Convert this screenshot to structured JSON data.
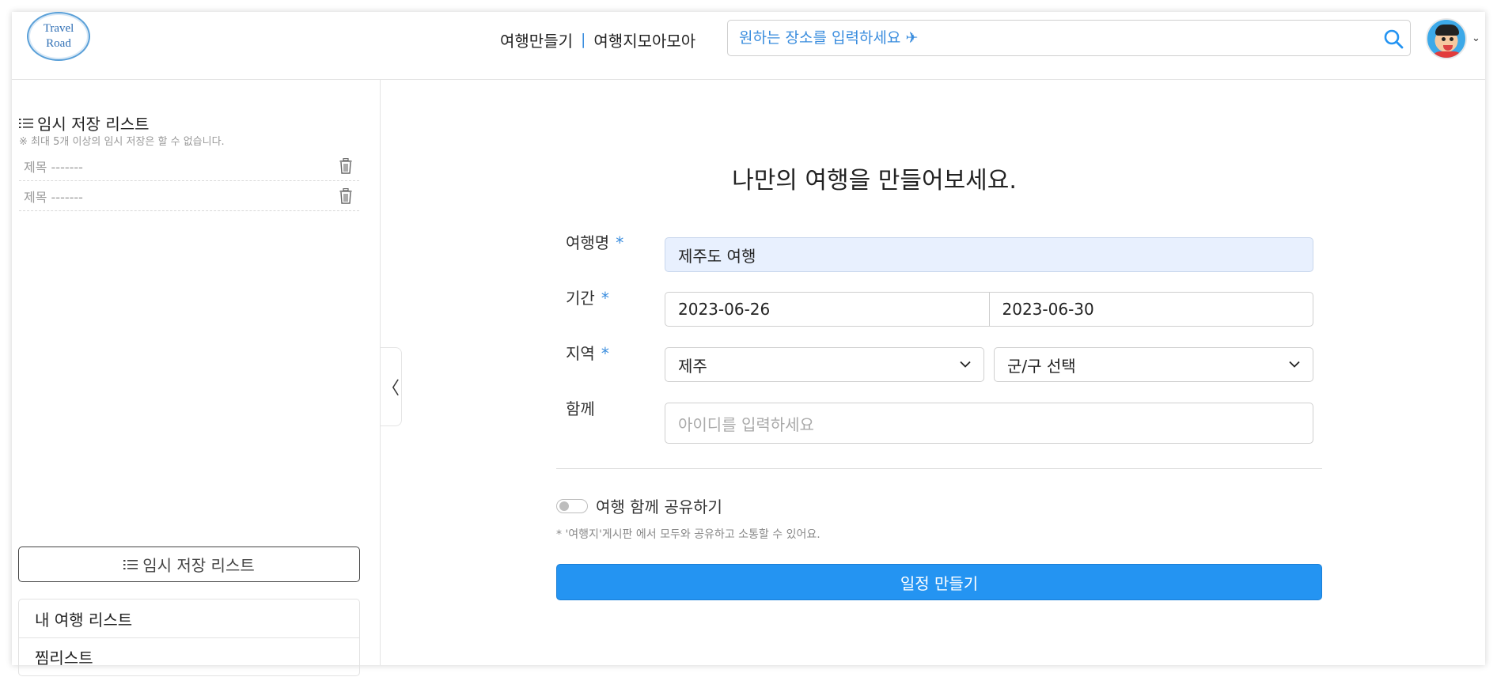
{
  "header": {
    "logo_line1": "Travel",
    "logo_line2": "Road",
    "nav": [
      {
        "label": "여행만들기"
      },
      {
        "label": "여행지모아모아"
      }
    ],
    "nav_separator": "|",
    "search": {
      "placeholder": "원하는 장소를 입력하세요 ✈"
    },
    "avatar_caret": "⌄"
  },
  "sidebar": {
    "title": "임시 저장 리스트",
    "subtitle": "※ 최대 5개 이상의 임시 저장은 할 수 없습니다.",
    "temp_items": [
      {
        "label": "제목 -------"
      },
      {
        "label": "제목 -------"
      }
    ],
    "temp_button_label": "임시 저장 리스트",
    "links": [
      {
        "label": "내 여행 리스트"
      },
      {
        "label": "찜리스트"
      }
    ],
    "collapse_glyph": "〈"
  },
  "form": {
    "title": "나만의 여행을 만들어보세요.",
    "required_mark": "*",
    "trip_name": {
      "label": "여행명",
      "value": "제주도 여행"
    },
    "period": {
      "label": "기간",
      "start": "2023-06-26",
      "end": "2023-06-30"
    },
    "region": {
      "label": "지역",
      "province": "제주",
      "district": "군/구 선택"
    },
    "together": {
      "label": "함께",
      "placeholder": "아이디를 입력하세요"
    },
    "share_toggle_label": "여행 함께 공유하기",
    "share_toggle_on": false,
    "note": "* '여행지'게시판 에서 모두와 공유하고 소통할 수 있어요.",
    "submit_label": "일정 만들기"
  },
  "colors": {
    "accent": "#2494f2",
    "link_blue": "#3a8dde",
    "filled_input": "#e8f0fe"
  }
}
